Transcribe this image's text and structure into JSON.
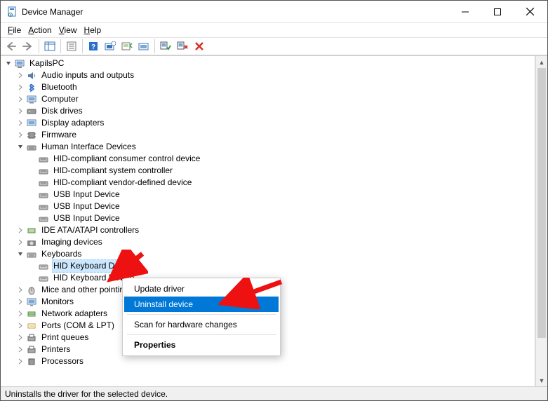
{
  "window": {
    "title": "Device Manager"
  },
  "menubar": {
    "file": "File",
    "action": "Action",
    "view": "View",
    "help": "Help"
  },
  "tree": {
    "root": "KapilsPC",
    "items": [
      {
        "label": "Audio inputs and outputs",
        "icon": "audio"
      },
      {
        "label": "Bluetooth",
        "icon": "bt"
      },
      {
        "label": "Computer",
        "icon": "pc"
      },
      {
        "label": "Disk drives",
        "icon": "disk"
      },
      {
        "label": "Display adapters",
        "icon": "display"
      },
      {
        "label": "Firmware",
        "icon": "chip"
      }
    ],
    "hid_label": "Human Interface Devices",
    "hid_children": [
      "HID-compliant consumer control device",
      "HID-compliant system controller",
      "HID-compliant vendor-defined device",
      "USB Input Device",
      "USB Input Device",
      "USB Input Device"
    ],
    "after_hid": [
      {
        "label": "IDE ATA/ATAPI controllers",
        "icon": "ide"
      },
      {
        "label": "Imaging devices",
        "icon": "cam"
      }
    ],
    "kb_label": "Keyboards",
    "kb_children": [
      "HID Keyboard Device",
      "HID Keyboard Device"
    ],
    "after_kb": [
      {
        "label": "Mice and other pointing devices",
        "icon": "mouse"
      },
      {
        "label": "Monitors",
        "icon": "monitor"
      },
      {
        "label": "Network adapters",
        "icon": "net"
      },
      {
        "label": "Ports (COM & LPT)",
        "icon": "port"
      },
      {
        "label": "Print queues",
        "icon": "printq"
      },
      {
        "label": "Printers",
        "icon": "printer"
      },
      {
        "label": "Processors",
        "icon": "cpu"
      }
    ]
  },
  "context_menu": {
    "update": "Update driver",
    "uninstall": "Uninstall device",
    "scan": "Scan for hardware changes",
    "properties": "Properties"
  },
  "statusbar": {
    "text": "Uninstalls the driver for the selected device."
  }
}
